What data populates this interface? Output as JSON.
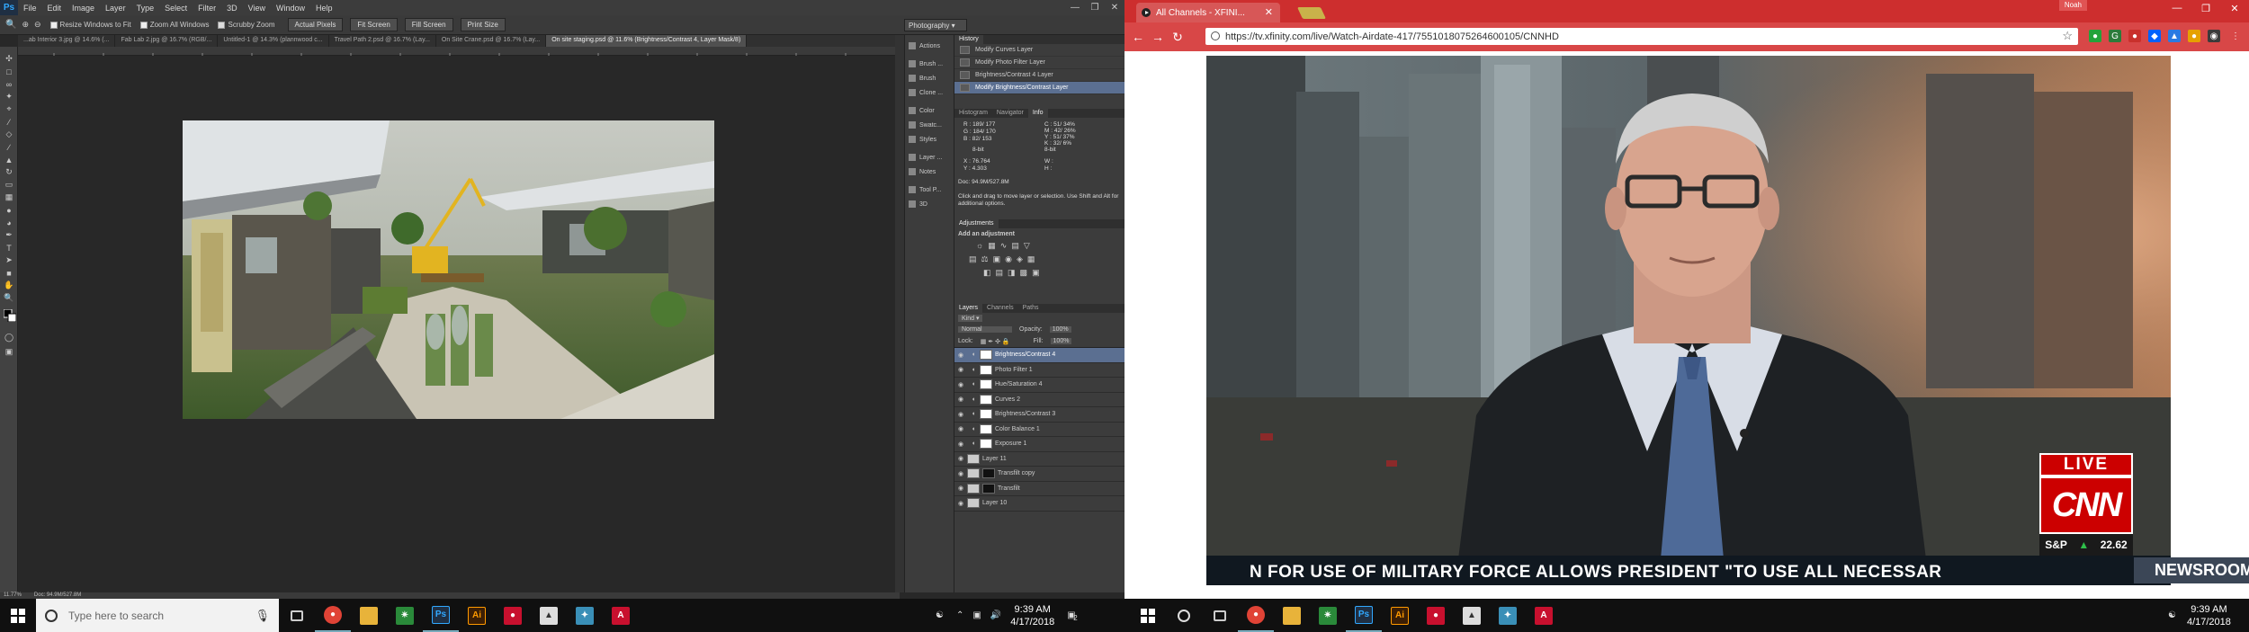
{
  "photoshop": {
    "logo": "Ps",
    "menu": [
      "File",
      "Edit",
      "Image",
      "Layer",
      "Type",
      "Select",
      "Filter",
      "3D",
      "View",
      "Window",
      "Help"
    ],
    "options": {
      "resize_windows": "Resize Windows to Fit",
      "zoom_all": "Zoom All Windows",
      "scrubby_zoom": "Scrubby Zoom",
      "buttons": [
        "Actual Pixels",
        "Fit Screen",
        "Fill Screen",
        "Print Size"
      ]
    },
    "workspace": "Photography",
    "tabs": [
      "...ab Interior 3.jpg @ 14.6% (...",
      "Fab Lab 2.jpg @ 16.7% (RGB/...",
      "Untitled-1 @ 14.3% (plannwood c...",
      "Travel Path 2.psd @ 16.7% (Lay...",
      "On Site Crane.psd @ 16.7% (Lay...",
      "On site staging.psd @ 11.6% (Brightness/Contrast 4, Layer Mask/8)"
    ],
    "dock": [
      "Actions",
      "Brush ...",
      "Brush",
      "Clone ...",
      "Color",
      "Swatc...",
      "Styles",
      "Layer ...",
      "Notes",
      "Tool P...",
      "3D"
    ],
    "history": {
      "title": "History",
      "items": [
        "Modify Curves Layer",
        "Modify Photo Filter Layer",
        "Brightness/Contrast 4 Layer",
        "Modify Brightness/Contrast Layer"
      ]
    },
    "info": {
      "tabs": [
        "Histogram",
        "Navigator",
        "Info"
      ],
      "rgb": [
        "R :  189/ 177",
        "G :  184/ 170",
        "B :   82/ 153"
      ],
      "cmyk": [
        "C :  51/ 34%",
        "M :  42/ 26%",
        "Y :  51/ 37%",
        "K :  32/  6%"
      ],
      "bit_left": "8-bit",
      "bit_right": "8-bit",
      "xy": [
        "X :  76.764",
        "Y :   4.303"
      ],
      "wh": [
        "W :",
        "H :"
      ],
      "doc": "Doc: 94.9M/527.8M",
      "hint": "Click and drag to move layer or selection. Use Shift and Alt for additional options."
    },
    "adjustments": {
      "title": "Adjustments",
      "add": "Add an adjustment"
    },
    "layers": {
      "tabs": [
        "Layers",
        "Channels",
        "Paths"
      ],
      "kind": "Kind",
      "blend": "Normal",
      "opacity_label": "Opacity:",
      "opacity": "100%",
      "lock_label": "Lock:",
      "fill_label": "Fill:",
      "fill": "100%",
      "items": [
        "Brightness/Contrast 4",
        "Photo Filter 1",
        "Hue/Saturation 4",
        "Curves 2",
        "Brightness/Contrast 3",
        "Color Balance 1",
        "Exposure 1",
        "Layer 11",
        "Transfilt copy",
        "Transfilt",
        "Layer 10"
      ]
    },
    "status": {
      "zoom": "11.77%",
      "doc": "Doc: 94.9M/527.8M"
    }
  },
  "chrome": {
    "tab_title": "All Channels - XFINI...",
    "user": "Noah",
    "url": "https://tv.xfinity.com/live/Watch-Airdate-417/7551018075264600105/CNNHD",
    "live": "LIVE",
    "network": "CNN",
    "market": "S&P",
    "market_value": "22.62",
    "ticker": "N FOR USE OF MILITARY FORCE ALLOWS PRESIDENT \"TO USE ALL NECESSAR",
    "show": "NEWSROOM"
  },
  "taskbar_left": {
    "search_placeholder": "Type here to search",
    "time": "9:39 AM",
    "date": "4/17/2018",
    "notif": "2"
  },
  "taskbar_right": {
    "time": "9:39 AM",
    "date": "4/17/2018"
  }
}
